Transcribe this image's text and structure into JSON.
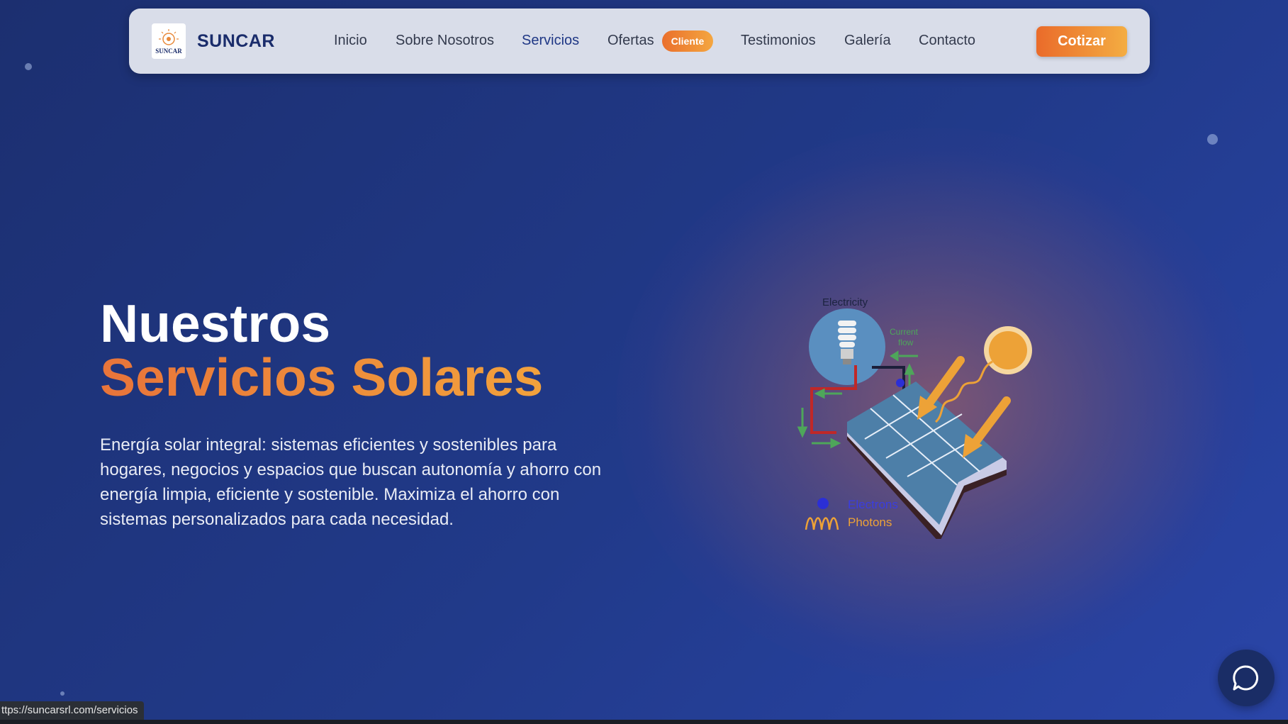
{
  "navbar": {
    "logo_icon": "suncar-logo",
    "logo_text": "SUNCAR",
    "brand": "SUNCAR",
    "links": [
      {
        "label": "Inicio"
      },
      {
        "label": "Sobre Nosotros"
      },
      {
        "label": "Servicios",
        "active": true
      },
      {
        "label": "Ofertas"
      },
      {
        "label": "Testimonios"
      },
      {
        "label": "Galería"
      },
      {
        "label": "Contacto"
      }
    ],
    "offers_badge": "Cliente",
    "cta_label": "Cotizar"
  },
  "hero": {
    "title_line1": "Nuestros",
    "title_line2": "Servicios Solares",
    "description": "Energía solar integral: sistemas eficientes y sostenibles para hogares, negocios y espacios que buscan autonomía y ahorro con energía limpia, eficiente y sostenible. Maximiza el ahorro con sistemas personalizados para cada necesidad."
  },
  "illustration": {
    "label_electricity": "Electricity",
    "label_current_line1": "Current",
    "label_current_line2": "flow",
    "label_electrons": "Electrons",
    "label_photons": "Photons",
    "icons": [
      "lightbulb-icon",
      "sun-icon",
      "solar-panel-icon",
      "photon-wave-icon",
      "electron-dot-icon"
    ]
  },
  "status_bar": {
    "url": "ttps://suncarsrl.com/servicios"
  },
  "chat": {
    "icon": "chat-bubble-icon"
  },
  "colors": {
    "accent_orange": "#ee8a36",
    "brand_navy": "#1a2c6b",
    "background_blue": "#213a8a",
    "navbar_bg": "#d9dde9"
  }
}
